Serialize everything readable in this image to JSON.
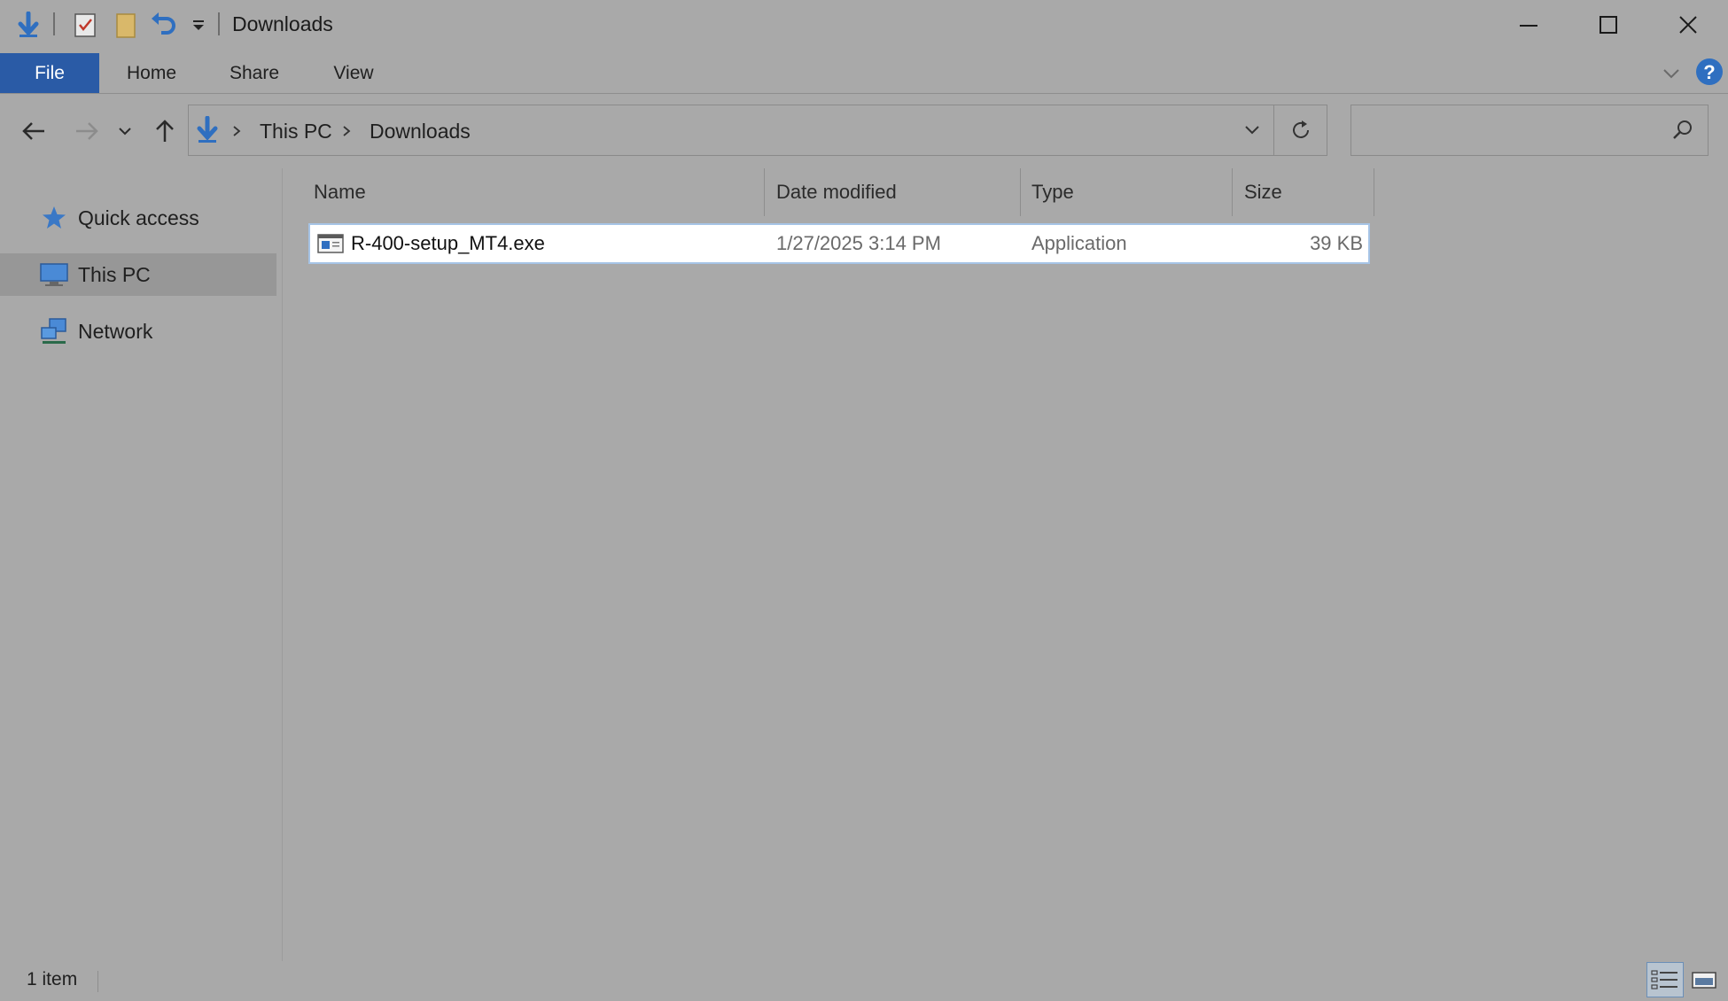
{
  "window": {
    "title": "Downloads",
    "minimize_icon": "minimize-icon",
    "maximize_icon": "maximize-icon",
    "close_icon": "close-icon"
  },
  "quick_access_toolbar": {
    "icons": [
      "downloads-arrow-icon",
      "properties-icon",
      "new-folder-icon",
      "undo-icon",
      "customize-dropdown-icon"
    ]
  },
  "ribbon": {
    "tabs": [
      {
        "label": "File"
      },
      {
        "label": "Home"
      },
      {
        "label": "Share"
      },
      {
        "label": "View"
      }
    ]
  },
  "address_bar": {
    "crumbs": [
      "This PC",
      "Downloads"
    ]
  },
  "search": {
    "placeholder": ""
  },
  "sidebar": {
    "items": [
      {
        "label": "Quick access",
        "icon": "star-icon"
      },
      {
        "label": "This PC",
        "icon": "computer-icon",
        "selected": true
      },
      {
        "label": "Network",
        "icon": "network-icon"
      }
    ]
  },
  "columns": [
    {
      "label": "Name"
    },
    {
      "label": "Date modified"
    },
    {
      "label": "Type"
    },
    {
      "label": "Size"
    }
  ],
  "files": [
    {
      "name": "R-400-setup_MT4.exe",
      "date_modified": "1/27/2025 3:14 PM",
      "type": "Application",
      "size": "39 KB",
      "selected": true
    }
  ],
  "status_bar": {
    "item_count": "1 item"
  },
  "colors": {
    "file_tab": "#2a5ba6",
    "accent_blue": "#2f6fc0",
    "background": "#a9a9a9"
  }
}
